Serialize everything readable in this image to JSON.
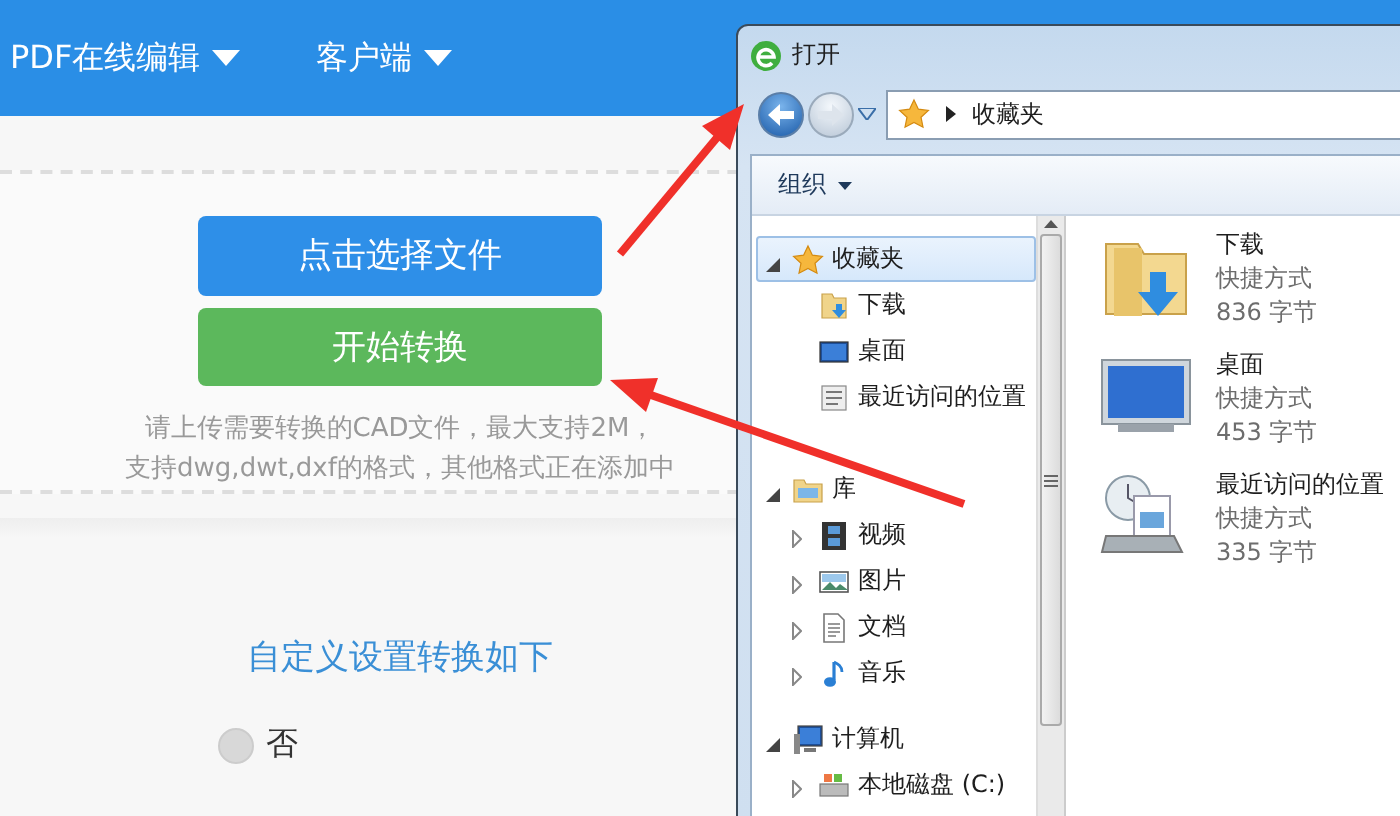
{
  "header": {
    "nav": [
      {
        "label": "PDF在线编辑"
      },
      {
        "label": "客户端"
      }
    ]
  },
  "upload": {
    "buttons": [
      {
        "label": "点击选择文件",
        "kind": "primary"
      },
      {
        "label": "开始转换",
        "kind": "success"
      }
    ],
    "hint": [
      "请上传需要转换的CAD文件，最大支持2M，",
      "支持dwg,dwt,dxf的格式，其他格式正在添加中"
    ]
  },
  "settings": {
    "title": "自定义设置转换如下",
    "options": [
      {
        "label": "否",
        "selected": false
      }
    ]
  },
  "dialog": {
    "title": "打开",
    "address": "收藏夹",
    "toolbar": [
      {
        "label": "组织"
      }
    ],
    "tree": [
      {
        "label": "收藏夹",
        "kind": "star",
        "expanded": true,
        "selected": true,
        "children": [
          {
            "label": "下载",
            "kind": "download",
            "selected": false
          },
          {
            "label": "桌面",
            "kind": "desktop",
            "selected": false
          },
          {
            "label": "最近访问的位置",
            "kind": "recent",
            "selected": false
          }
        ]
      },
      {
        "label": "库",
        "kind": "library",
        "expanded": true,
        "selected": false,
        "children": [
          {
            "label": "视频",
            "kind": "video",
            "expanded": false,
            "selected": false
          },
          {
            "label": "图片",
            "kind": "picture",
            "expanded": false,
            "selected": false
          },
          {
            "label": "文档",
            "kind": "document",
            "expanded": false,
            "selected": false
          },
          {
            "label": "音乐",
            "kind": "music",
            "expanded": false,
            "selected": false
          }
        ]
      },
      {
        "label": "计算机",
        "kind": "computer",
        "expanded": true,
        "selected": false,
        "children": [
          {
            "label": "本地磁盘 (C:)",
            "kind": "disk",
            "expanded": false,
            "selected": false
          }
        ]
      }
    ],
    "files": [
      {
        "name": "下载",
        "kind": "download",
        "type": "快捷方式",
        "size": "836 字节"
      },
      {
        "name": "桌面",
        "kind": "desktop",
        "type": "快捷方式",
        "size": "453 字节"
      },
      {
        "name": "最近访问的位置",
        "kind": "recent",
        "type": "快捷方式",
        "size": "335 字节"
      }
    ]
  }
}
